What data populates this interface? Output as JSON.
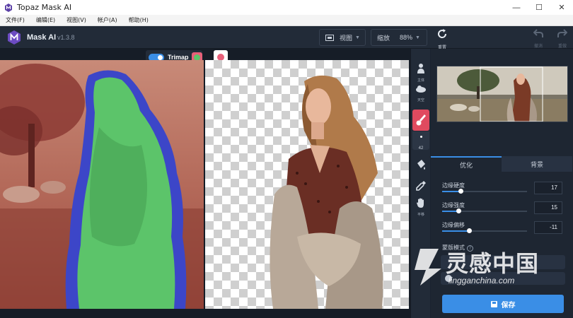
{
  "window": {
    "title": "Topaz Mask AI",
    "controls": {
      "minimize": "—",
      "maximize": "☐",
      "close": "✕"
    }
  },
  "menu": [
    {
      "label": "文件(F)"
    },
    {
      "label": "编辑(E)"
    },
    {
      "label": "视图(V)"
    },
    {
      "label": "帐户(A)"
    },
    {
      "label": "帮助(H)"
    }
  ],
  "toolbar": {
    "app_name": "Mask AI",
    "version": "v1.3.8",
    "view_label": "视图",
    "zoom_label": "缩放",
    "zoom_value": "88%",
    "reset_label": "重置",
    "undo_label": "撤消",
    "redo_label": "重做"
  },
  "canvas": {
    "trimap_label": "Trimap",
    "trimap_enabled": true
  },
  "tools": [
    {
      "label": "主体",
      "icon": "person-select-icon"
    },
    {
      "label": "天空",
      "icon": "sky-select-icon"
    },
    {
      "label": "",
      "icon": "brush-icon",
      "active": true
    },
    {
      "label": "",
      "icon": "fill-bucket-icon"
    },
    {
      "label": "",
      "icon": "eyedropper-icon"
    },
    {
      "label": "平移",
      "icon": "hand-pan-icon"
    }
  ],
  "brush_size": "42",
  "panel": {
    "tabs": [
      {
        "label": "优化",
        "selected": true
      },
      {
        "label": "背景",
        "selected": false
      }
    ],
    "sliders": [
      {
        "label": "边缘硬度",
        "value": "17",
        "fraction": 0.22
      },
      {
        "label": "边缘强度",
        "value": "15",
        "fraction": 0.19
      },
      {
        "label": "边缘偏移",
        "value": "-11",
        "fraction": 0.32
      }
    ],
    "mask_mode_label": "蒙版模式",
    "save_label": "保存"
  },
  "watermark": {
    "cn": "灵感中国",
    "en": "lingganchina.com"
  },
  "colors": {
    "accent": "#3a8ee6",
    "active_tool": "#e04a5f",
    "foreground_mask": "#5cc46a",
    "background_mask": "#e8607a",
    "edge_mask": "#3c46c8"
  }
}
